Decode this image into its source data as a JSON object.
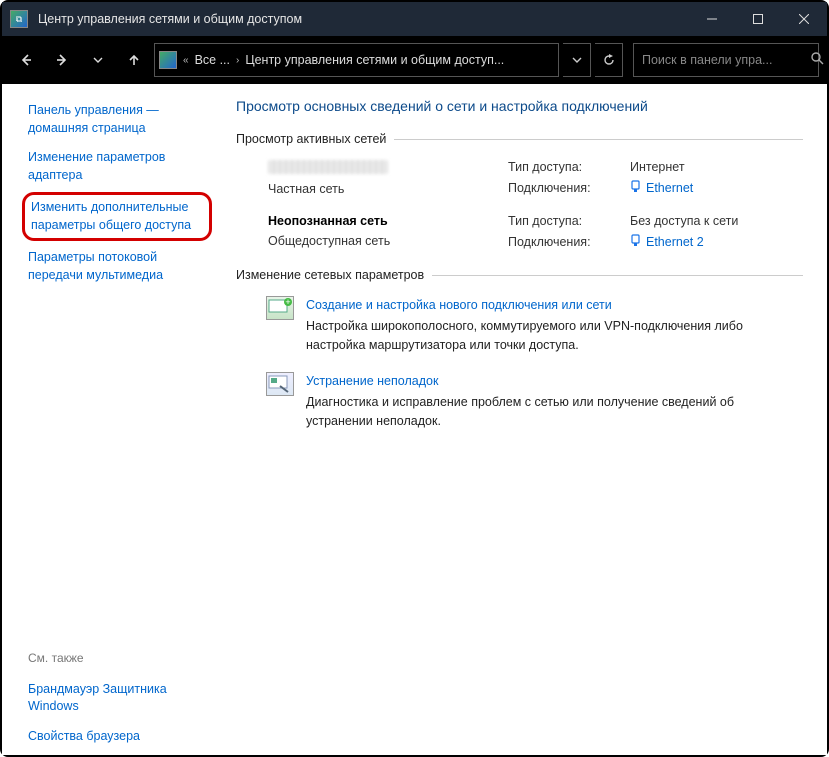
{
  "window": {
    "title": "Центр управления сетями и общим доступом"
  },
  "breadcrumb": {
    "seg1": "Все ...",
    "seg2": "Центр управления сетями и общим доступ..."
  },
  "search": {
    "placeholder": "Поиск в панели упра..."
  },
  "sidebar": {
    "cp_home": "Панель управления — домашняя страница",
    "adapter": "Изменение параметров адаптера",
    "advanced": "Изменить дополнительные параметры общего доступа",
    "media": "Параметры потоковой передачи мультимедиа",
    "see_also_hdr": "См. также",
    "firewall": "Брандмауэр Защитника Windows",
    "browser": "Свойства браузера"
  },
  "content": {
    "heading": "Просмотр основных сведений о сети и настройка подключений",
    "active_hdr": "Просмотр активных сетей",
    "change_hdr": "Изменение сетевых параметров"
  },
  "nets": [
    {
      "name_hidden": true,
      "name": "",
      "type": "Частная сеть",
      "access_lbl": "Тип доступа:",
      "access_val": "Интернет",
      "conn_lbl": "Подключения:",
      "conn_val": "Ethernet"
    },
    {
      "name_hidden": false,
      "name": "Неопознанная сеть",
      "type": "Общедоступная сеть",
      "access_lbl": "Тип доступа:",
      "access_val": "Без доступа к сети",
      "conn_lbl": "Подключения:",
      "conn_val": "Ethernet 2"
    }
  ],
  "actions": {
    "new_conn_title": "Создание и настройка нового подключения или сети",
    "new_conn_desc": "Настройка широкополосного, коммутируемого или VPN-подключения либо настройка маршрутизатора или точки доступа.",
    "troubleshoot_title": "Устранение неполадок",
    "troubleshoot_desc": "Диагностика и исправление проблем с сетью или получение сведений об устранении неполадок."
  }
}
